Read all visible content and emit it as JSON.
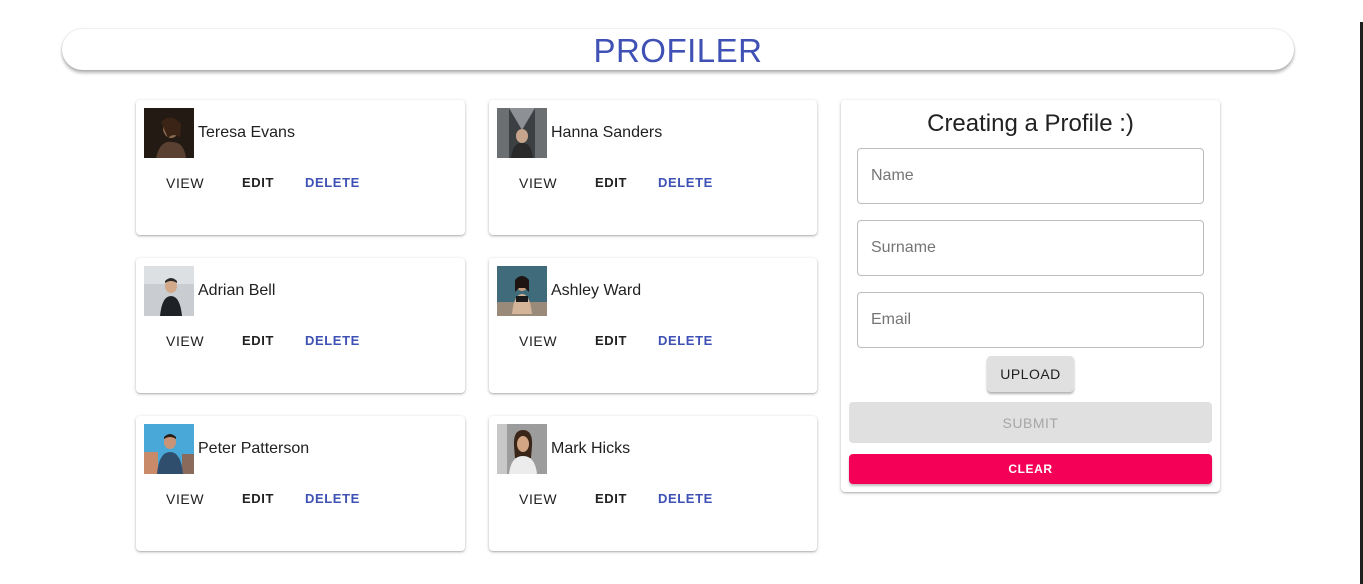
{
  "header": {
    "title": "PROFILER"
  },
  "profiles": [
    {
      "name": "Teresa Evans",
      "view_label": "VIEW",
      "edit_label": "EDIT",
      "delete_label": "DELETE"
    },
    {
      "name": "Hanna Sanders",
      "view_label": "VIEW",
      "edit_label": "EDIT",
      "delete_label": "DELETE"
    },
    {
      "name": "Adrian Bell",
      "view_label": "VIEW",
      "edit_label": "EDIT",
      "delete_label": "DELETE"
    },
    {
      "name": "Ashley Ward",
      "view_label": "VIEW",
      "edit_label": "EDIT",
      "delete_label": "DELETE"
    },
    {
      "name": "Peter Patterson",
      "view_label": "VIEW",
      "edit_label": "EDIT",
      "delete_label": "DELETE"
    },
    {
      "name": "Mark Hicks",
      "view_label": "VIEW",
      "edit_label": "EDIT",
      "delete_label": "DELETE"
    }
  ],
  "form": {
    "title": "Creating a Profile :)",
    "name": {
      "value": "",
      "placeholder": "Name"
    },
    "surname": {
      "value": "",
      "placeholder": "Surname"
    },
    "email": {
      "value": "",
      "placeholder": "Email"
    },
    "upload_label": "UPLOAD",
    "submit_label": "SUBMIT",
    "clear_label": "CLEAR"
  },
  "colors": {
    "primary": "#3f51b5",
    "secondary": "#f50057",
    "disabled_bg": "#e0e0e0",
    "disabled_text": "#a6a6a6"
  }
}
